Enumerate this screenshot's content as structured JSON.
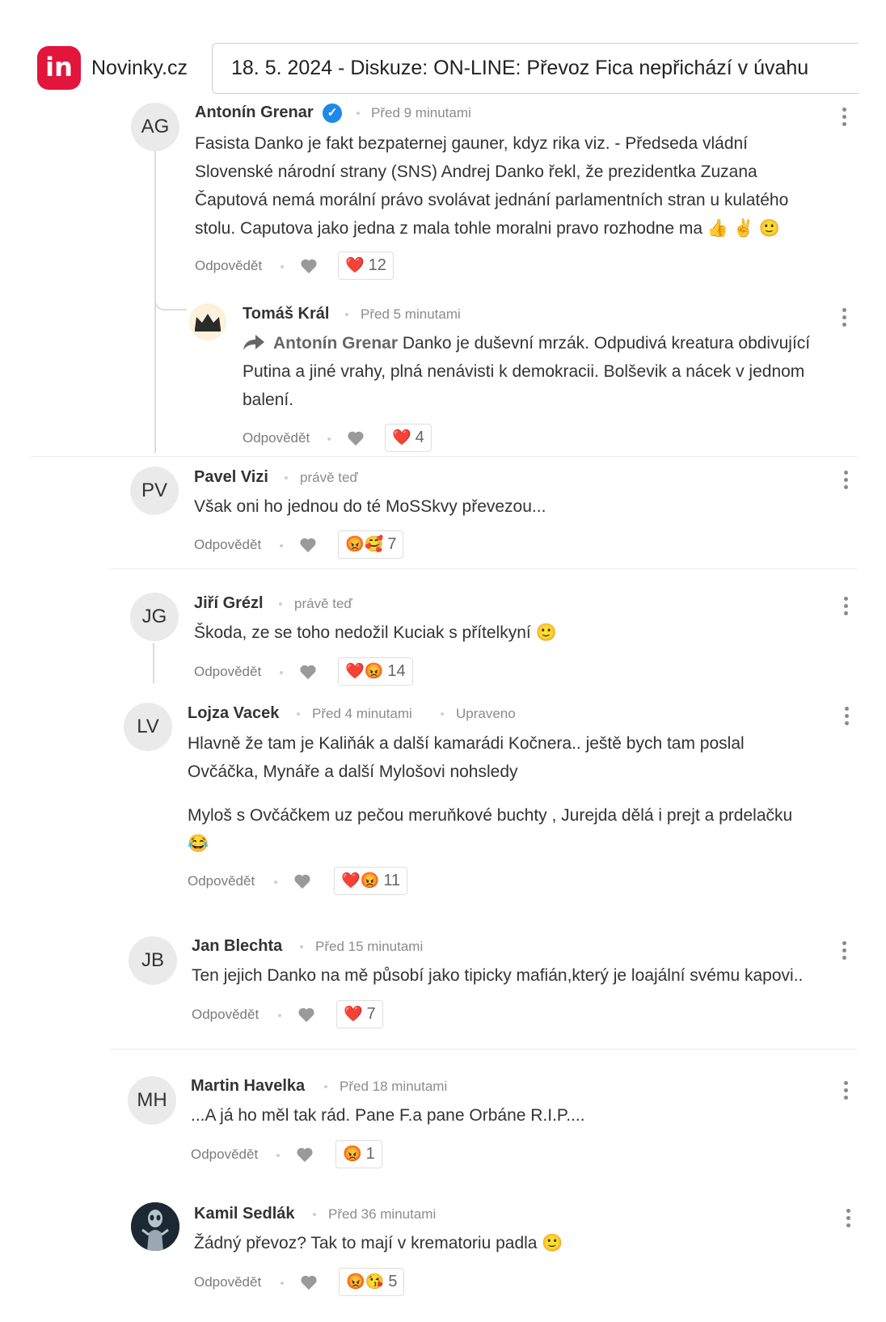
{
  "header": {
    "logo_text": "in",
    "site_name": "Novinky.cz",
    "headline": "18. 5. 2024 - Diskuze: ON-LINE: Převoz Fica nepřichází v úvahu"
  },
  "ui": {
    "reply_label": "Odpovědět",
    "edited_label": "Upraveno"
  },
  "comments": [
    {
      "author": "Antonín Grenar",
      "initials": "AG",
      "verified": true,
      "time": "Před 9 minutami",
      "lines": [
        "Fasista Danko je fakt bezpaternej gauner, kdyz rika viz. - Předseda vládní",
        "Slovenské národní strany (SNS) Andrej Danko řekl, že prezidentka Zuzana",
        "Čaputová nemá morální právo svolávat jednání parlamentních stran u kulatého",
        "stolu. Caputova jako jedna z mala tohle moralni pravo rozhodne ma 👍 ✌ 🙂"
      ],
      "reaction_emoji": "❤️",
      "reaction_count": "12"
    },
    {
      "author": "Tomáš Král",
      "avatar_icon": "crown-icon",
      "time": "Před 5 minutami",
      "mention": "Antonín Grenar",
      "lines": [
        "Danko je duševní mrzák. Odpudivá kreatura obdivující",
        "Putina a jiné vrahy, plná nenávisti k demokracii. Bolševik a nácek v jednom",
        "balení."
      ],
      "reaction_emoji": "❤️",
      "reaction_count": "4"
    },
    {
      "author": "Pavel Vizi",
      "initials": "PV",
      "time": "právě teď",
      "lines": [
        "Však oni ho jednou do té MoSSkvy převezou..."
      ],
      "reaction_emoji": "😡🥰",
      "reaction_count": "7"
    },
    {
      "author": "Jiří Grézl",
      "initials": "JG",
      "time": "právě teď",
      "lines": [
        "Škoda, ze se toho nedožil Kuciak s přítelkyní 🙂"
      ],
      "reaction_emoji": "❤️😡",
      "reaction_count": "14"
    },
    {
      "author": "Lojza Vacek",
      "initials": "LV",
      "time": "Před 4 minutami",
      "lines": [
        "Hlavně že tam je Kaliňák a další kamarádi Kočnera.. ještě bych tam poslal",
        "Ovčáčka, Mynáře a další Mylošovi nohsledy"
      ],
      "lines2": [
        "Myloš s Ovčáčkem uz pečou meruňkové buchty , Jurejda dělá i prejt a prdelačku",
        "😂"
      ],
      "reaction_emoji": "❤️😡",
      "reaction_count": "11"
    },
    {
      "author": "Jan Blechta",
      "initials": "JB",
      "time": "Před 15 minutami",
      "lines": [
        "Ten jejich Danko na mě působí jako tipicky mafián,který je loajální svému kapovi.."
      ],
      "reaction_emoji": "❤️",
      "reaction_count": "7"
    },
    {
      "author": "Martin Havelka",
      "initials": "MH",
      "time": "Před 18 minutami",
      "lines": [
        "...A já ho měl tak rád. Pane F.a pane Orbáne R.I.P...."
      ],
      "reaction_emoji": "😡",
      "reaction_count": "1"
    },
    {
      "author": "Kamil Sedlák",
      "avatar_icon": "alien-avatar-icon",
      "time": "Před 36 minutami",
      "lines": [
        "Žádný převoz? Tak to mají v krematoriu padla 🙂"
      ],
      "reaction_emoji": "😡😘",
      "reaction_count": "5"
    }
  ]
}
